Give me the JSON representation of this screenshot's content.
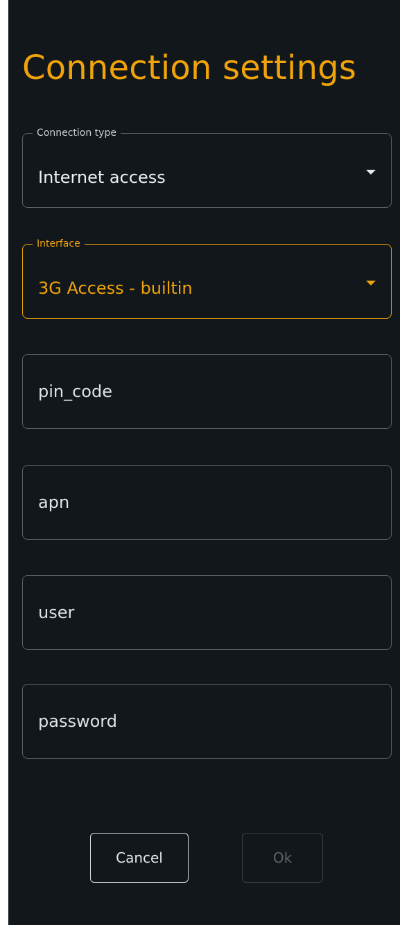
{
  "dialog": {
    "title": "Connection settings"
  },
  "fields": {
    "connection_type": {
      "label": "Connection type",
      "value": "Internet access"
    },
    "interface": {
      "label": "Interface",
      "value": "3G Access - builtin"
    },
    "pin_code": {
      "placeholder": "pin_code"
    },
    "apn": {
      "placeholder": "apn"
    },
    "user": {
      "placeholder": "user"
    },
    "password": {
      "placeholder": "password"
    }
  },
  "buttons": {
    "cancel_label": "Cancel",
    "ok_label": "Ok"
  },
  "colors": {
    "background": "#11171a",
    "accent": "#f0a30a",
    "border": "#5b6267",
    "text": "#eef1f2",
    "disabled_text": "#5d6468"
  },
  "icons": {
    "dropdown": "caret-down-icon"
  }
}
